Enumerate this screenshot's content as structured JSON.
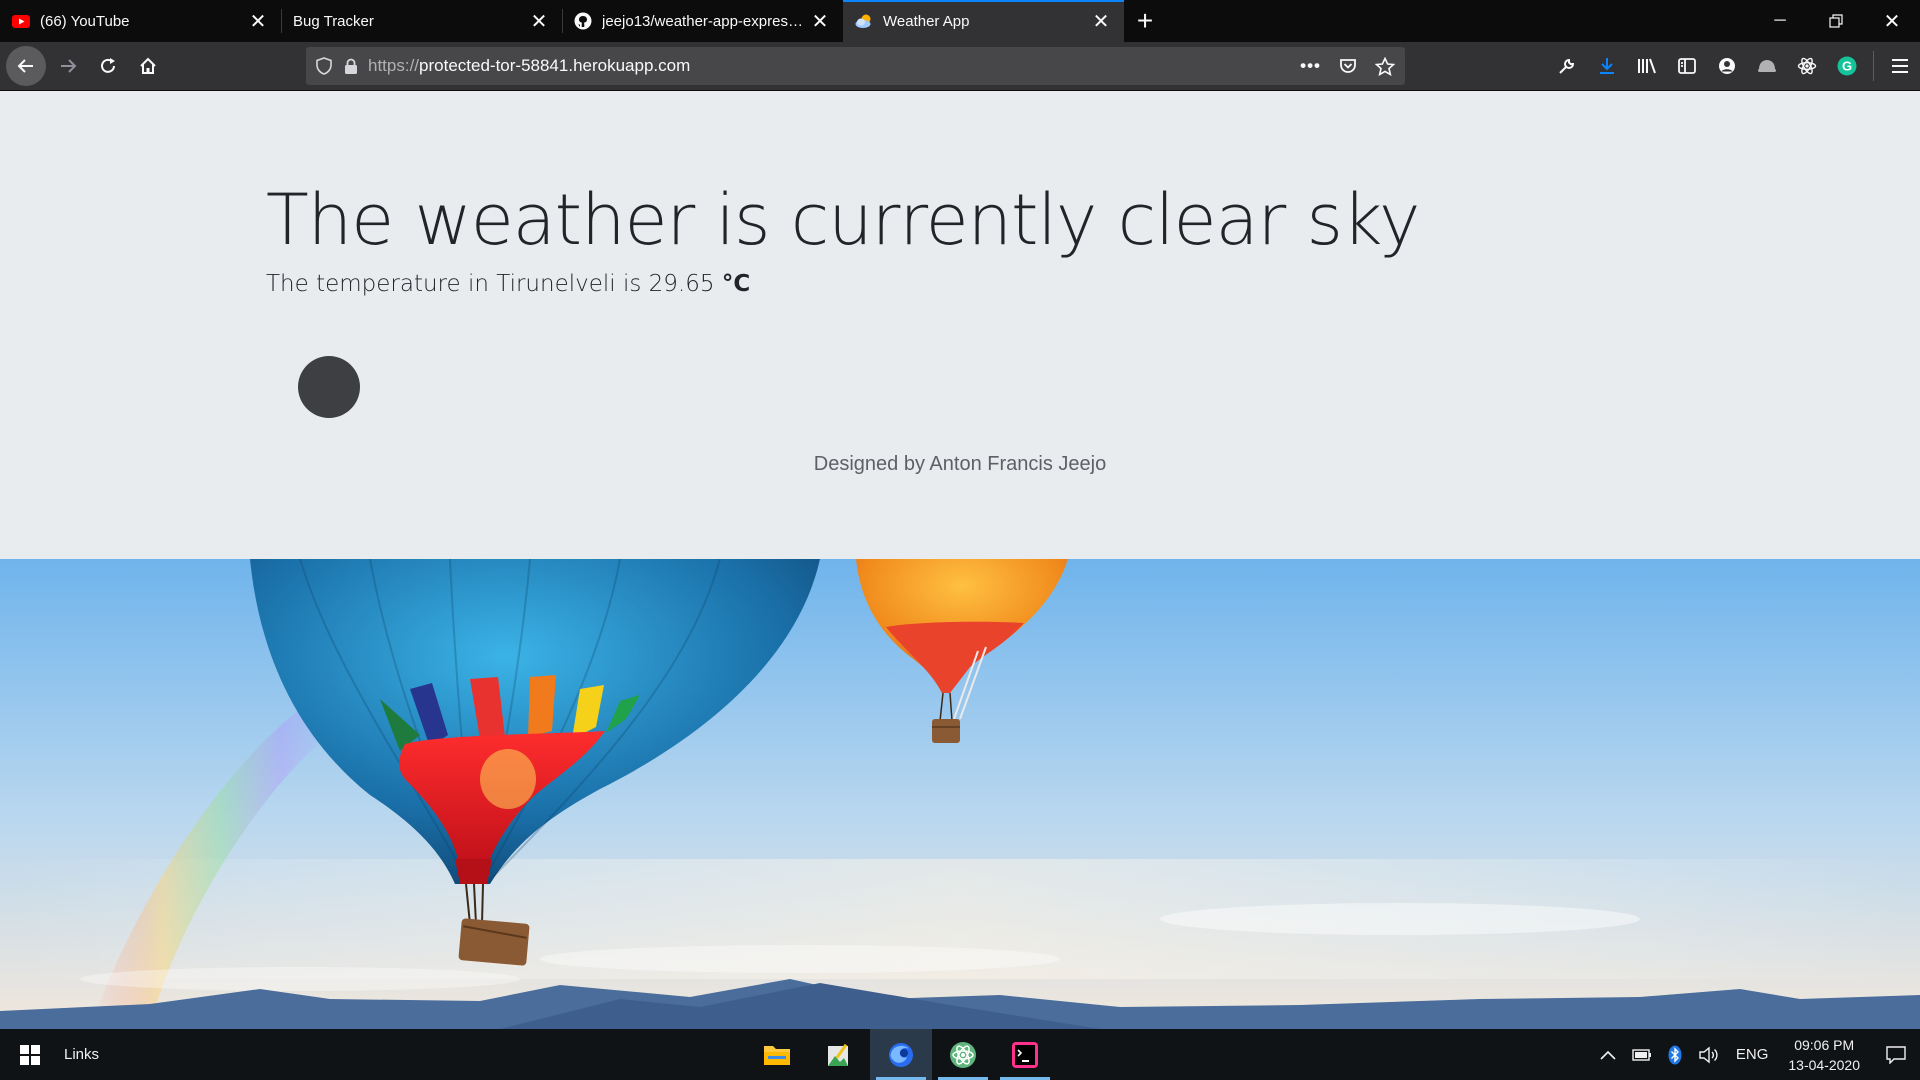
{
  "browser": {
    "tabs": [
      {
        "title": "(66) YouTube",
        "icon": "youtube-icon"
      },
      {
        "title": "Bug Tracker",
        "icon": "none"
      },
      {
        "title": "jeejo13/weather-app-expressJS",
        "icon": "github-icon"
      },
      {
        "title": "Weather App",
        "icon": "weather-icon",
        "active": true
      }
    ],
    "url_protocol": "https://",
    "url_host": "protected-tor-58841.herokuapp.com",
    "accent_color": "#0a84ff"
  },
  "page": {
    "headline": "The weather is currently clear sky",
    "temperature_text": "The temperature in Tirunelveli is 29.65",
    "temperature_unit": "°C",
    "credit": "Designed by Anton Francis Jeejo"
  },
  "taskbar": {
    "links_label": "Links",
    "language": "ENG",
    "time": "09:06 PM",
    "date": "13-04-2020"
  }
}
